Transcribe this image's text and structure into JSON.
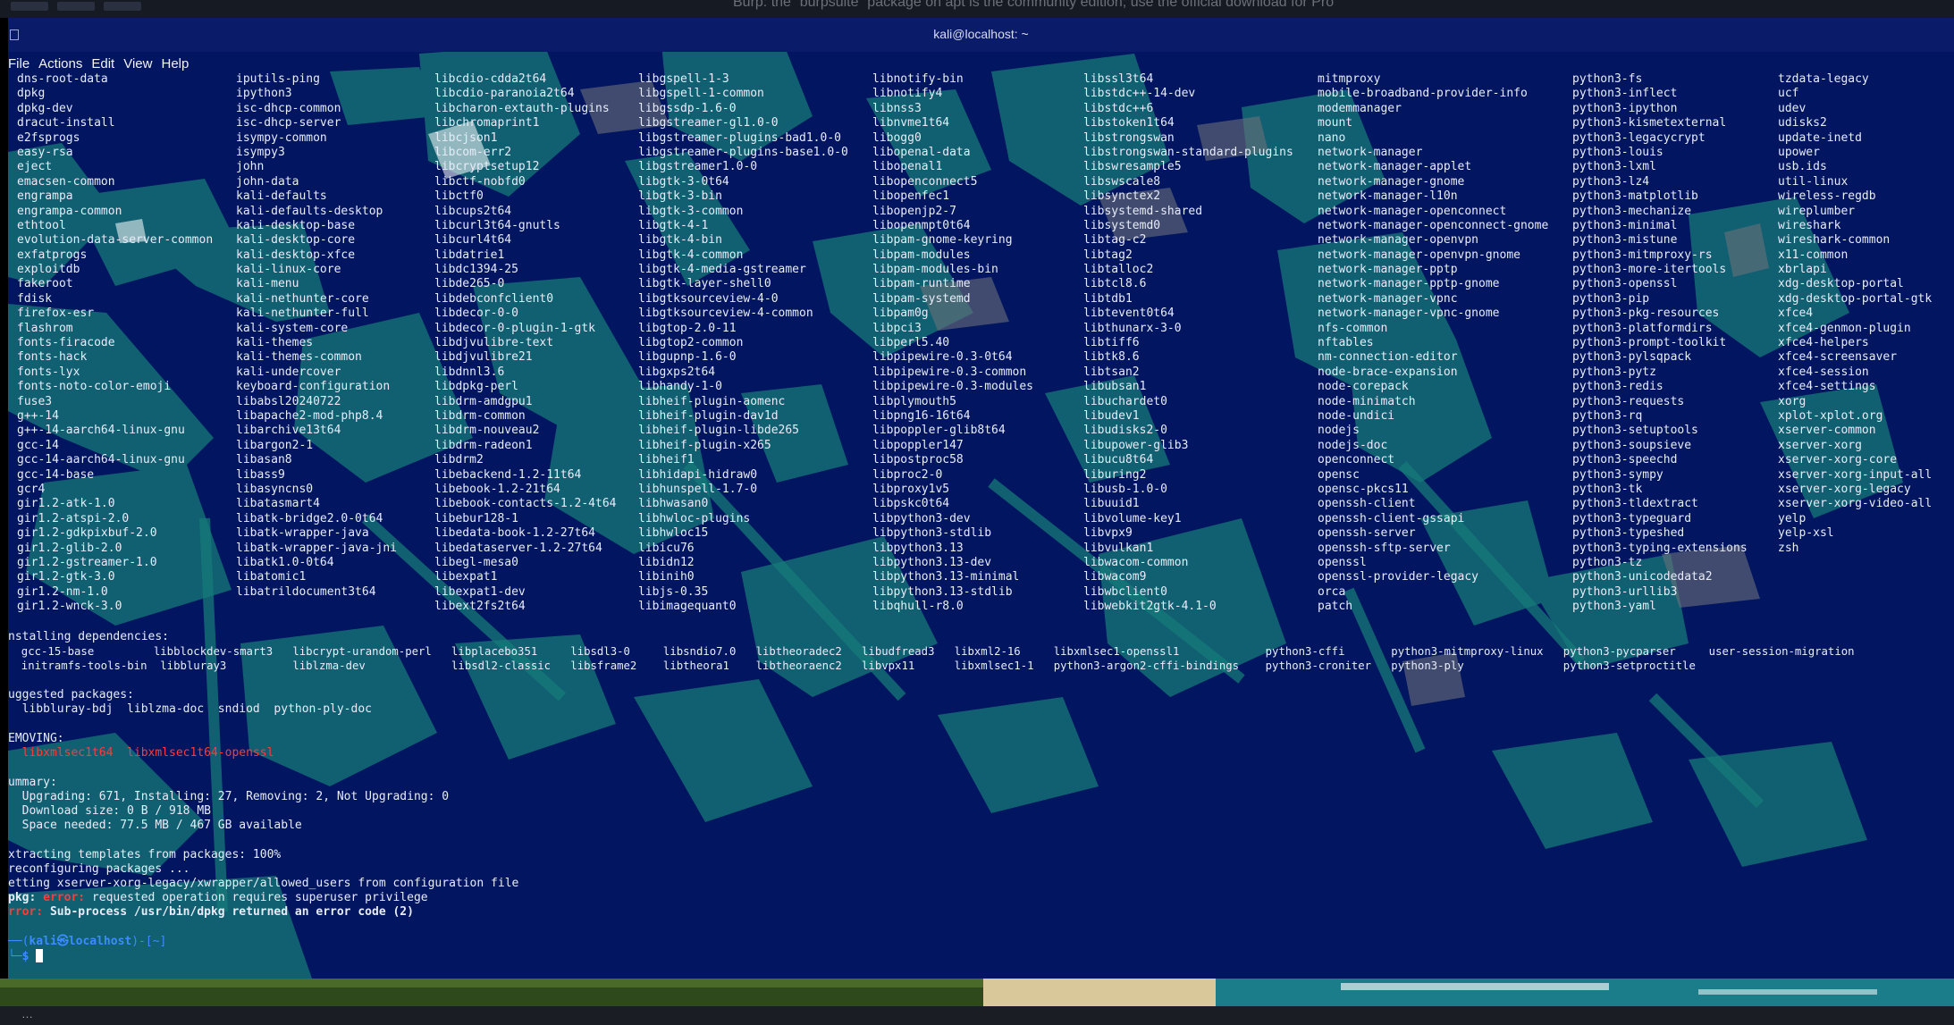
{
  "background_page_text": "Burp: the `burpsuite` package on apt is the community edition; use the official download for Pro",
  "window": {
    "title": "kali@localhost: ~"
  },
  "menu": [
    "File",
    "Actions",
    "Edit",
    "View",
    "Help"
  ],
  "package_columns": [
    [
      "dns-root-data",
      "dpkg",
      "dpkg-dev",
      "dracut-install",
      "e2fsprogs",
      "easy-rsa",
      "eject",
      "emacsen-common",
      "engrampa",
      "engrampa-common",
      "ethtool",
      "evolution-data-server-common",
      "exfatprogs",
      "exploitdb",
      "fakeroot",
      "fdisk",
      "firefox-esr",
      "flashrom",
      "fonts-firacode",
      "fonts-hack",
      "fonts-lyx",
      "fonts-noto-color-emoji",
      "fuse3",
      "g++-14",
      "g++-14-aarch64-linux-gnu",
      "gcc-14",
      "gcc-14-aarch64-linux-gnu",
      "gcc-14-base",
      "gcr4",
      "gir1.2-atk-1.0",
      "gir1.2-atspi-2.0",
      "gir1.2-gdkpixbuf-2.0",
      "gir1.2-glib-2.0",
      "gir1.2-gstreamer-1.0",
      "gir1.2-gtk-3.0",
      "gir1.2-nm-1.0",
      "gir1.2-wnck-3.0"
    ],
    [
      "iputils-ping",
      "ipython3",
      "isc-dhcp-common",
      "isc-dhcp-server",
      "isympy-common",
      "isympy3",
      "john",
      "john-data",
      "kali-defaults",
      "kali-defaults-desktop",
      "kali-desktop-base",
      "kali-desktop-core",
      "kali-desktop-xfce",
      "kali-linux-core",
      "kali-menu",
      "kali-nethunter-core",
      "kali-nethunter-full",
      "kali-system-core",
      "kali-themes",
      "kali-themes-common",
      "kali-undercover",
      "keyboard-configuration",
      "libabsl20240722",
      "libapache2-mod-php8.4",
      "libarchive13t64",
      "libargon2-1",
      "libasan8",
      "libass9",
      "libasyncns0",
      "libatasmart4",
      "libatk-bridge2.0-0t64",
      "libatk-wrapper-java",
      "libatk-wrapper-java-jni",
      "libatk1.0-0t64",
      "libatomic1",
      "libatrildocument3t64"
    ],
    [
      "libcdio-cdda2t64",
      "libcdio-paranoia2t64",
      "libcharon-extauth-plugins",
      "libchromaprint1",
      "libcjson1",
      "libcom-err2",
      "libcryptsetup12",
      "libctf-nobfd0",
      "libctf0",
      "libcups2t64",
      "libcurl3t64-gnutls",
      "libcurl4t64",
      "libdatrie1",
      "libdc1394-25",
      "libde265-0",
      "libdebconfclient0",
      "libdecor-0-0",
      "libdecor-0-plugin-1-gtk",
      "libdjvulibre-text",
      "libdjvulibre21",
      "libdnnl3.6",
      "libdpkg-perl",
      "libdrm-amdgpu1",
      "libdrm-common",
      "libdrm-nouveau2",
      "libdrm-radeon1",
      "libdrm2",
      "libebackend-1.2-11t64",
      "libebook-1.2-21t64",
      "libebook-contacts-1.2-4t64",
      "libebur128-1",
      "libedata-book-1.2-27t64",
      "libedataserver-1.2-27t64",
      "libegl-mesa0",
      "libexpat1",
      "libexpat1-dev",
      "libext2fs2t64"
    ],
    [
      "libgspell-1-3",
      "libgspell-1-common",
      "libgssdp-1.6-0",
      "libgstreamer-gl1.0-0",
      "libgstreamer-plugins-bad1.0-0",
      "libgstreamer-plugins-base1.0-0",
      "libgstreamer1.0-0",
      "libgtk-3-0t64",
      "libgtk-3-bin",
      "libgtk-3-common",
      "libgtk-4-1",
      "libgtk-4-bin",
      "libgtk-4-common",
      "libgtk-4-media-gstreamer",
      "libgtk-layer-shell0",
      "libgtksourceview-4-0",
      "libgtksourceview-4-common",
      "libgtop-2.0-11",
      "libgtop2-common",
      "libgupnp-1.6-0",
      "libgxps2t64",
      "libhandy-1-0",
      "libheif-plugin-aomenc",
      "libheif-plugin-dav1d",
      "libheif-plugin-libde265",
      "libheif-plugin-x265",
      "libheif1",
      "libhidapi-hidraw0",
      "libhunspell-1.7-0",
      "libhwasan0",
      "libhwloc-plugins",
      "libhwloc15",
      "libicu76",
      "libidn12",
      "libinih0",
      "libjs-0.35",
      "libimagequant0"
    ],
    [
      "libnotify-bin",
      "libnotify4",
      "libnss3",
      "libnvme1t64",
      "libogg0",
      "libopenal-data",
      "libopenal1",
      "libopenconnect5",
      "libopenfec1",
      "libopenjp2-7",
      "libopenmpt0t64",
      "libpam-gnome-keyring",
      "libpam-modules",
      "libpam-modules-bin",
      "libpam-runtime",
      "libpam-systemd",
      "libpam0g",
      "libpci3",
      "libperl5.40",
      "libpipewire-0.3-0t64",
      "libpipewire-0.3-common",
      "libpipewire-0.3-modules",
      "libplymouth5",
      "libpng16-16t64",
      "libpoppler-glib8t64",
      "libpoppler147",
      "libpostproc58",
      "libproc2-0",
      "libproxy1v5",
      "libpskc0t64",
      "libpython3-dev",
      "libpython3-stdlib",
      "libpython3.13",
      "libpython3.13-dev",
      "libpython3.13-minimal",
      "libpython3.13-stdlib",
      "libqhull-r8.0"
    ],
    [
      "libssl3t64",
      "libstdc++-14-dev",
      "libstdc++6",
      "libstoken1t64",
      "libstrongswan",
      "libstrongswan-standard-plugins",
      "libswresample5",
      "libswscale8",
      "libsynctex2",
      "libsystemd-shared",
      "libsystemd0",
      "libtag-c2",
      "libtag2",
      "libtalloc2",
      "libtcl8.6",
      "libtdb1",
      "libtevent0t64",
      "libthunarx-3-0",
      "libtiff6",
      "libtk8.6",
      "libtsan2",
      "libubsan1",
      "libuchardet0",
      "libudev1",
      "libudisks2-0",
      "libupower-glib3",
      "libucu8t64",
      "liburing2",
      "libusb-1.0-0",
      "libuuid1",
      "libvolume-key1",
      "libvpx9",
      "libvulkan1",
      "libwacom-common",
      "libwacom9",
      "libwbclient0",
      "libwebkit2gtk-4.1-0"
    ],
    [
      "mitmproxy",
      "mobile-broadband-provider-info",
      "modemmanager",
      "mount",
      "nano",
      "network-manager",
      "network-manager-applet",
      "network-manager-gnome",
      "network-manager-l10n",
      "network-manager-openconnect",
      "network-manager-openconnect-gnome",
      "network-manager-openvpn",
      "network-manager-openvpn-gnome",
      "network-manager-pptp",
      "network-manager-pptp-gnome",
      "network-manager-vpnc",
      "network-manager-vpnc-gnome",
      "nfs-common",
      "nftables",
      "nm-connection-editor",
      "node-brace-expansion",
      "node-corepack",
      "node-minimatch",
      "node-undici",
      "nodejs",
      "nodejs-doc",
      "openconnect",
      "opensc",
      "opensc-pkcs11",
      "openssh-client",
      "openssh-client-gssapi",
      "openssh-server",
      "openssh-sftp-server",
      "openssl",
      "openssl-provider-legacy",
      "orca",
      "patch"
    ],
    [
      "python3-fs",
      "python3-inflect",
      "python3-ipython",
      "python3-kismetexternal",
      "python3-legacycrypt",
      "python3-louis",
      "python3-lxml",
      "python3-lz4",
      "python3-matplotlib",
      "python3-mechanize",
      "python3-minimal",
      "python3-mistune",
      "python3-mitmproxy-rs",
      "python3-more-itertools",
      "python3-openssl",
      "python3-pip",
      "python3-pkg-resources",
      "python3-platformdirs",
      "python3-prompt-toolkit",
      "python3-pylsqpack",
      "python3-pytz",
      "python3-redis",
      "python3-requests",
      "python3-rq",
      "python3-setuptools",
      "python3-soupsieve",
      "python3-speechd",
      "python3-sympy",
      "python3-tk",
      "python3-tldextract",
      "python3-typeguard",
      "python3-typeshed",
      "python3-typing-extensions",
      "python3-tz",
      "python3-unicodedata2",
      "python3-urllib3",
      "python3-yaml"
    ],
    [
      "tzdata-legacy",
      "ucf",
      "udev",
      "udisks2",
      "update-inetd",
      "upower",
      "usb.ids",
      "util-linux",
      "wireless-regdb",
      "wireplumber",
      "wireshark",
      "wireshark-common",
      "x11-common",
      "xbrlapi",
      "xdg-desktop-portal",
      "xdg-desktop-portal-gtk",
      "xfce4",
      "xfce4-genmon-plugin",
      "xfce4-helpers",
      "xfce4-screensaver",
      "xfce4-session",
      "xfce4-settings",
      "xorg",
      "xplot-xplot.org",
      "xserver-common",
      "xserver-xorg",
      "xserver-xorg-core",
      "xserver-xorg-input-all",
      "xserver-xorg-legacy",
      "xserver-xorg-video-all",
      "yelp",
      "yelp-xsl",
      "zsh"
    ]
  ],
  "dependencies_header": "nstalling dependencies:",
  "dependencies_line1": "  gcc-15-base         libblockdev-smart3   libcrypt-urandom-perl   libplacebo351     libsdl3-0     libsndio7.0   libtheoradec2   libudfread3   libxml2-16     libxmlsec1-openssl1             python3-cffi       python3-mitmproxy-linux   python3-pycparser     user-session-migration",
  "dependencies_line2": "  initramfs-tools-bin  libbluray3          liblzma-dev             libsdl2-classic   libsframe2    libtheora1    libtheoraenc2   libvpx11      libxmlsec1-1   python3-argon2-cffi-bindings    python3-croniter   python3-ply               python3-setproctitle",
  "suggested_header": "uggested packages:",
  "suggested_line": "  libbluray-bdj  liblzma-doc  sndiod  python-ply-doc",
  "removing_header": "EMOVING:",
  "removing_line": "  libxmlsec1t64  libxmlsec1t64-openssl",
  "summary_header": "ummary:",
  "summary_lines": [
    "  Upgrading: 671, Installing: 27, Removing: 2, Not Upgrading: 0",
    "  Download size: 0 B / 918 MB",
    "  Space needed: 77.5 MB / 467 GB available"
  ],
  "extract_line": "xtracting templates from packages: 100%",
  "reconfig_line": "reconfiguring packages ...",
  "setting_line": "etting xserver-xorg-legacy/xwrapper/allowed_users from configuration file",
  "dpkg_prefix": "pkg: ",
  "dpkg_error_word": "error:",
  "dpkg_error_msg": " requested operation requires superuser privilege",
  "final_error_word": "rror:",
  "final_error_msg": " Sub-process /usr/bin/dpkg returned an error code (2)",
  "prompt": {
    "open": "──(",
    "user": "kali㉿localhost",
    "close": ")-[~]",
    "line2": "└─$ "
  }
}
